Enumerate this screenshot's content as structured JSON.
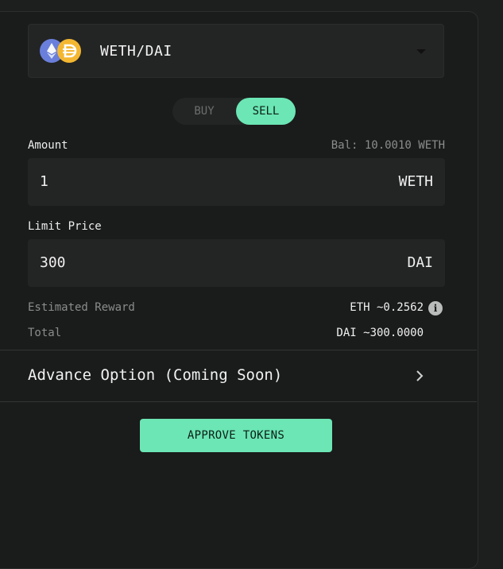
{
  "pair": {
    "label": "WETH/DAI",
    "icons": [
      "eth-icon",
      "dai-icon"
    ]
  },
  "side_toggle": {
    "buy": "BUY",
    "sell": "SELL",
    "selected": "SELL"
  },
  "amount": {
    "label": "Amount",
    "balance": "Bal: 10.0010 WETH",
    "value": "1",
    "unit": "WETH"
  },
  "limit_price": {
    "label": "Limit Price",
    "value": "300",
    "unit": "DAI"
  },
  "estimated_reward": {
    "label": "Estimated Reward",
    "value": "ETH ~0.2562"
  },
  "total": {
    "label": "Total",
    "value": "DAI ~300.0000"
  },
  "advance_option": {
    "label": "Advance Option (Coming Soon)"
  },
  "approve_button": {
    "label": "APPROVE TOKENS"
  },
  "colors": {
    "accent": "#6be6b4",
    "background": "#1a1b1b",
    "field": "#232524"
  }
}
